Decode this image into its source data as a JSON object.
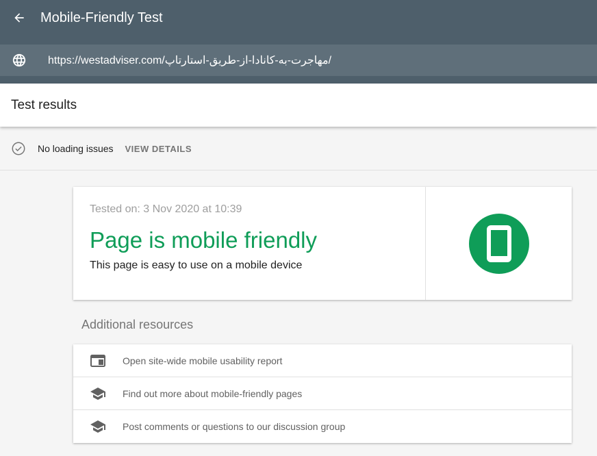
{
  "header": {
    "title": "Mobile-Friendly Test"
  },
  "url_bar": {
    "url": "https://westadviser.com/مهاجرت-به-کانادا-از-طریق-استارتاپ/"
  },
  "results": {
    "title": "Test results"
  },
  "status": {
    "text": "No loading issues",
    "action_label": "VIEW DETAILS"
  },
  "result_card": {
    "tested_on": "Tested on: 3 Nov 2020 at 10:39",
    "verdict": "Page is mobile friendly",
    "description": "This page is easy to use on a mobile device",
    "accent_color": "#0f9d58"
  },
  "resources": {
    "title": "Additional resources",
    "items": [
      {
        "label": "Open site-wide mobile usability report",
        "icon": "web-layout-icon"
      },
      {
        "label": "Find out more about mobile-friendly pages",
        "icon": "school-cap-icon"
      },
      {
        "label": "Post comments or questions to our discussion group",
        "icon": "school-cap-icon"
      }
    ]
  },
  "colors": {
    "top_bar": "#4e5f6b",
    "url_bar": "#5f6f7a",
    "success_green": "#0f9d58"
  }
}
